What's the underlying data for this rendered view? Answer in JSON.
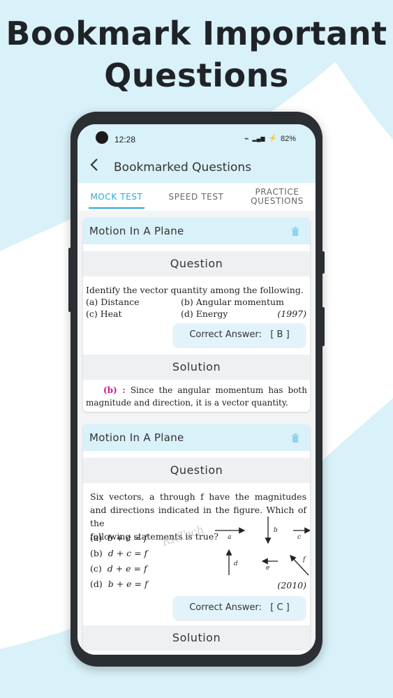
{
  "headline": {
    "line1": "Bookmark Important",
    "line2": "Questions"
  },
  "status_bar": {
    "time": "12:28",
    "battery": "82%",
    "battery_glyph": "⚡",
    "wifi_glyph": "⌁",
    "signal_glyph": "▂▄▆"
  },
  "app_bar": {
    "title": "Bookmarked Questions",
    "back_glyph": "‹"
  },
  "tabs": [
    {
      "label": "MOCK TEST",
      "active": true
    },
    {
      "label": "SPEED TEST",
      "active": false
    },
    {
      "label": "PRACTICE QUESTIONS",
      "active": false
    }
  ],
  "colors": {
    "accent": "#2aa7d8",
    "header_bg": "#d9f1f8",
    "answer_bg": "#e3f3fb",
    "highlight": "#c41e8a"
  },
  "cards": [
    {
      "chapter": "Motion In A Plane",
      "question_heading": "Question",
      "question_line1": "Identify the vector quantity among the following.",
      "options": [
        {
          "key": "(a)",
          "text": "Distance"
        },
        {
          "key": "(b)",
          "text": "Angular momentum"
        },
        {
          "key": "(c)",
          "text": "Heat"
        },
        {
          "key": "(d)",
          "text": "Energy"
        }
      ],
      "year": "(1997)",
      "correct_answer_label": "Correct Answer:",
      "correct_answer": "[ B ]",
      "solution_heading": "Solution",
      "solution_key": "(b) :",
      "solution_line1": "Since the angular momentum has both",
      "solution_line2": "magnitude and direction, it is a vector quantity."
    },
    {
      "chapter": "Motion In A Plane",
      "question_heading": "Question",
      "question_lines": [
        "Six vectors, a through f have the magnitudes",
        "and directions indicated in the figure. Which of the",
        "following statements is true?"
      ],
      "options": [
        {
          "key": "(a)",
          "text": "b + c = f"
        },
        {
          "key": "(b)",
          "text": "d + c = f"
        },
        {
          "key": "(c)",
          "text": "d + e = f"
        },
        {
          "key": "(d)",
          "text": "b + e = f"
        }
      ],
      "vector_labels": [
        "a",
        "b",
        "c",
        "d",
        "e",
        "f"
      ],
      "watermark": "RKTech",
      "year": "(2010)",
      "correct_answer_label": "Correct Answer:",
      "correct_answer": "[ C ]",
      "solution_heading": "Solution"
    }
  ]
}
